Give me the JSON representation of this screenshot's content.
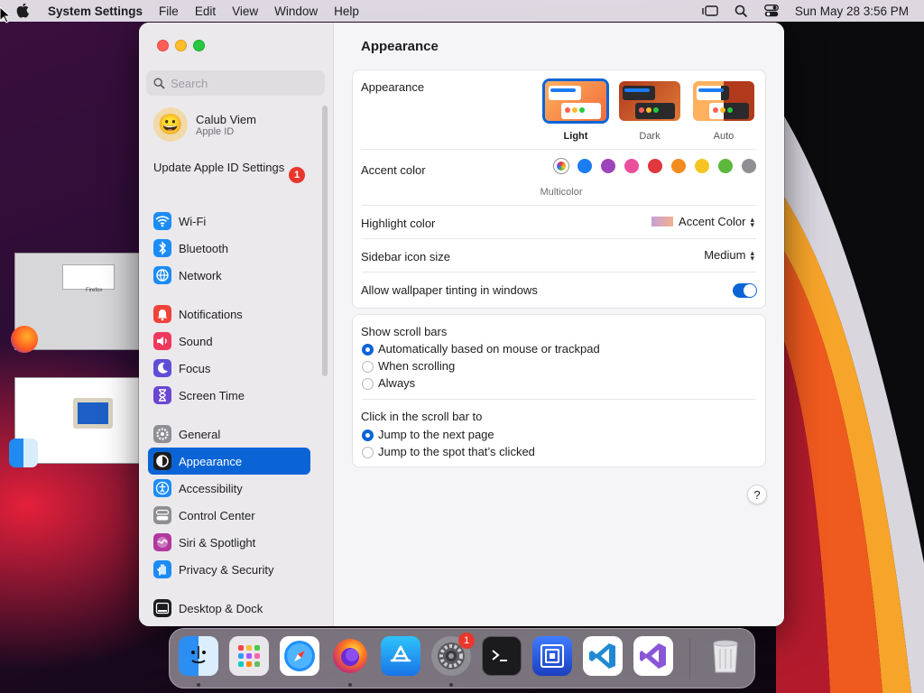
{
  "menubar": {
    "app_name": "System Settings",
    "menus": [
      "File",
      "Edit",
      "View",
      "Window",
      "Help"
    ],
    "datetime": "Sun May 28  3:56 PM"
  },
  "sidebar": {
    "search_placeholder": "Search",
    "profile": {
      "name": "Calub Viem",
      "subtitle": "Apple ID"
    },
    "update": {
      "label": "Update Apple ID Settings",
      "badge": "1"
    },
    "items": [
      {
        "label": "Wi-Fi",
        "icon": "wifi-icon",
        "color": "#1c8cf5"
      },
      {
        "label": "Bluetooth",
        "icon": "bluetooth-icon",
        "color": "#1c8cf5"
      },
      {
        "label": "Network",
        "icon": "globe-icon",
        "color": "#1c8cf5"
      },
      {
        "label": "Notifications",
        "icon": "bell-icon",
        "color": "#f0433a"
      },
      {
        "label": "Sound",
        "icon": "speaker-icon",
        "color": "#f0375e"
      },
      {
        "label": "Focus",
        "icon": "moon-icon",
        "color": "#5e4dd6"
      },
      {
        "label": "Screen Time",
        "icon": "hourglass-icon",
        "color": "#6a47d2"
      },
      {
        "label": "General",
        "icon": "gear-icon",
        "color": "#8e8e93"
      },
      {
        "label": "Appearance",
        "icon": "appearance-icon",
        "color": "#1c1c1e",
        "selected": true
      },
      {
        "label": "Accessibility",
        "icon": "accessibility-icon",
        "color": "#1c8cf5"
      },
      {
        "label": "Control Center",
        "icon": "toggles-icon",
        "color": "#8e8e93"
      },
      {
        "label": "Siri & Spotlight",
        "icon": "siri-icon",
        "color": "#b3379e"
      },
      {
        "label": "Privacy & Security",
        "icon": "hand-icon",
        "color": "#1c8cf5"
      },
      {
        "label": "Desktop & Dock",
        "icon": "dock-icon",
        "color": "#1c1c1e"
      }
    ]
  },
  "main": {
    "title": "Appearance",
    "appearance_label": "Appearance",
    "appearance_options": [
      {
        "label": "Light",
        "selected": true
      },
      {
        "label": "Dark"
      },
      {
        "label": "Auto"
      }
    ],
    "accent_label": "Accent color",
    "accent_colors": [
      "multicolor",
      "#1c7cf2",
      "#9c44b9",
      "#eb4f9c",
      "#e0383e",
      "#f48b1e",
      "#f6c523",
      "#5cb83b",
      "#8e8e93"
    ],
    "accent_selected_label": "Multicolor",
    "highlight_label": "Highlight color",
    "highlight_value": "Accent Color",
    "icon_size_label": "Sidebar icon size",
    "icon_size_value": "Medium",
    "tinting_label": "Allow wallpaper tinting in windows",
    "tinting_on": true,
    "scroll_bars_label": "Show scroll bars",
    "scroll_bars_options": [
      "Automatically based on mouse or trackpad",
      "When scrolling",
      "Always"
    ],
    "scroll_bars_selected": 0,
    "click_label": "Click in the scroll bar to",
    "click_options": [
      "Jump to the next page",
      "Jump to the spot that’s clicked"
    ],
    "click_selected": 0,
    "help": "?"
  },
  "dock": {
    "apps": [
      "finder-icon",
      "launchpad-icon",
      "safari-icon",
      "firefox-icon",
      "app-store-icon",
      "system-settings-icon",
      "terminal-icon",
      "screen-sharing-icon",
      "vscode-icon",
      "visual-studio-icon",
      "trash-icon"
    ],
    "settings_badge": "1"
  },
  "desktop": {
    "thumb_label": "Firefox"
  }
}
